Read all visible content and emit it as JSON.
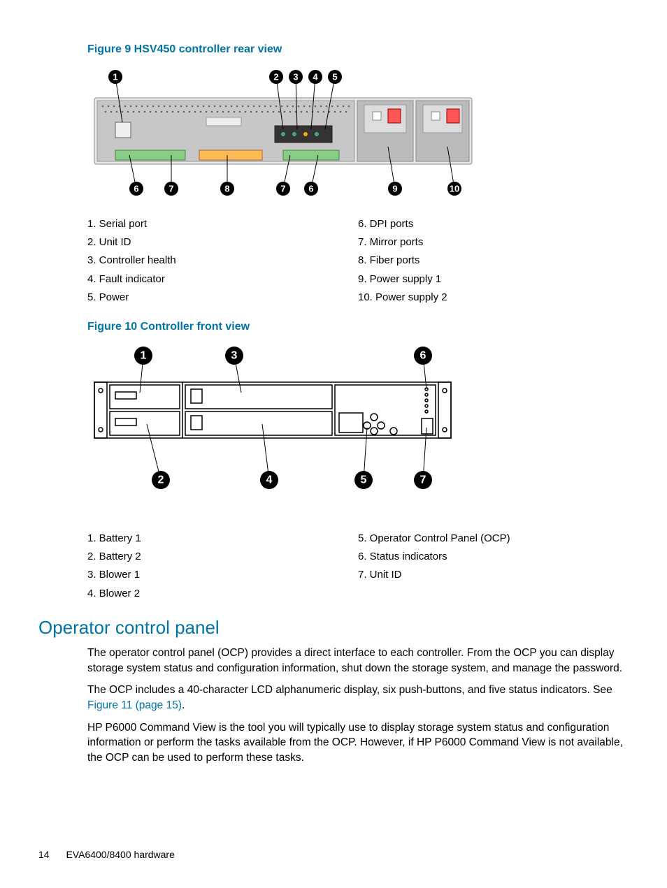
{
  "figure9": {
    "caption": "Figure 9 HSV450 controller rear view",
    "callouts": [
      "1",
      "2",
      "3",
      "4",
      "5",
      "6",
      "7",
      "8",
      "7",
      "6",
      "9",
      "10"
    ],
    "legend_left": [
      "1. Serial port",
      "2. Unit ID",
      "3. Controller health",
      "4. Fault indicator",
      "5. Power"
    ],
    "legend_right": [
      "6. DPI ports",
      "7. Mirror ports",
      "8. Fiber ports",
      "9. Power supply 1",
      "10. Power supply 2"
    ]
  },
  "figure10": {
    "caption": "Figure 10 Controller front view",
    "callouts_top": [
      "1",
      "3",
      "6"
    ],
    "callouts_bottom": [
      "2",
      "4",
      "5",
      "7"
    ],
    "legend_left": [
      "1. Battery 1",
      "2. Battery 2",
      "3. Blower 1",
      "4. Blower 2"
    ],
    "legend_right": [
      "5. Operator Control Panel (OCP)",
      "6. Status indicators",
      "7. Unit ID"
    ]
  },
  "section": {
    "title": "Operator control panel",
    "p1": "The operator control panel (OCP) provides a direct interface to each controller. From the OCP you can display storage system status and configuration information, shut down the storage system, and manage the password.",
    "p2a": "The OCP includes a 40-character LCD alphanumeric display, six push-buttons, and five status indicators. See ",
    "p2_link": "Figure 11 (page 15)",
    "p2b": ".",
    "p3": "HP P6000 Command View is the tool you will typically use to display storage system status and configuration information or perform the tasks available from the OCP. However, if HP P6000 Command View is not available, the OCP can be used to perform these tasks."
  },
  "footer": {
    "page": "14",
    "title": "EVA6400/8400 hardware"
  }
}
